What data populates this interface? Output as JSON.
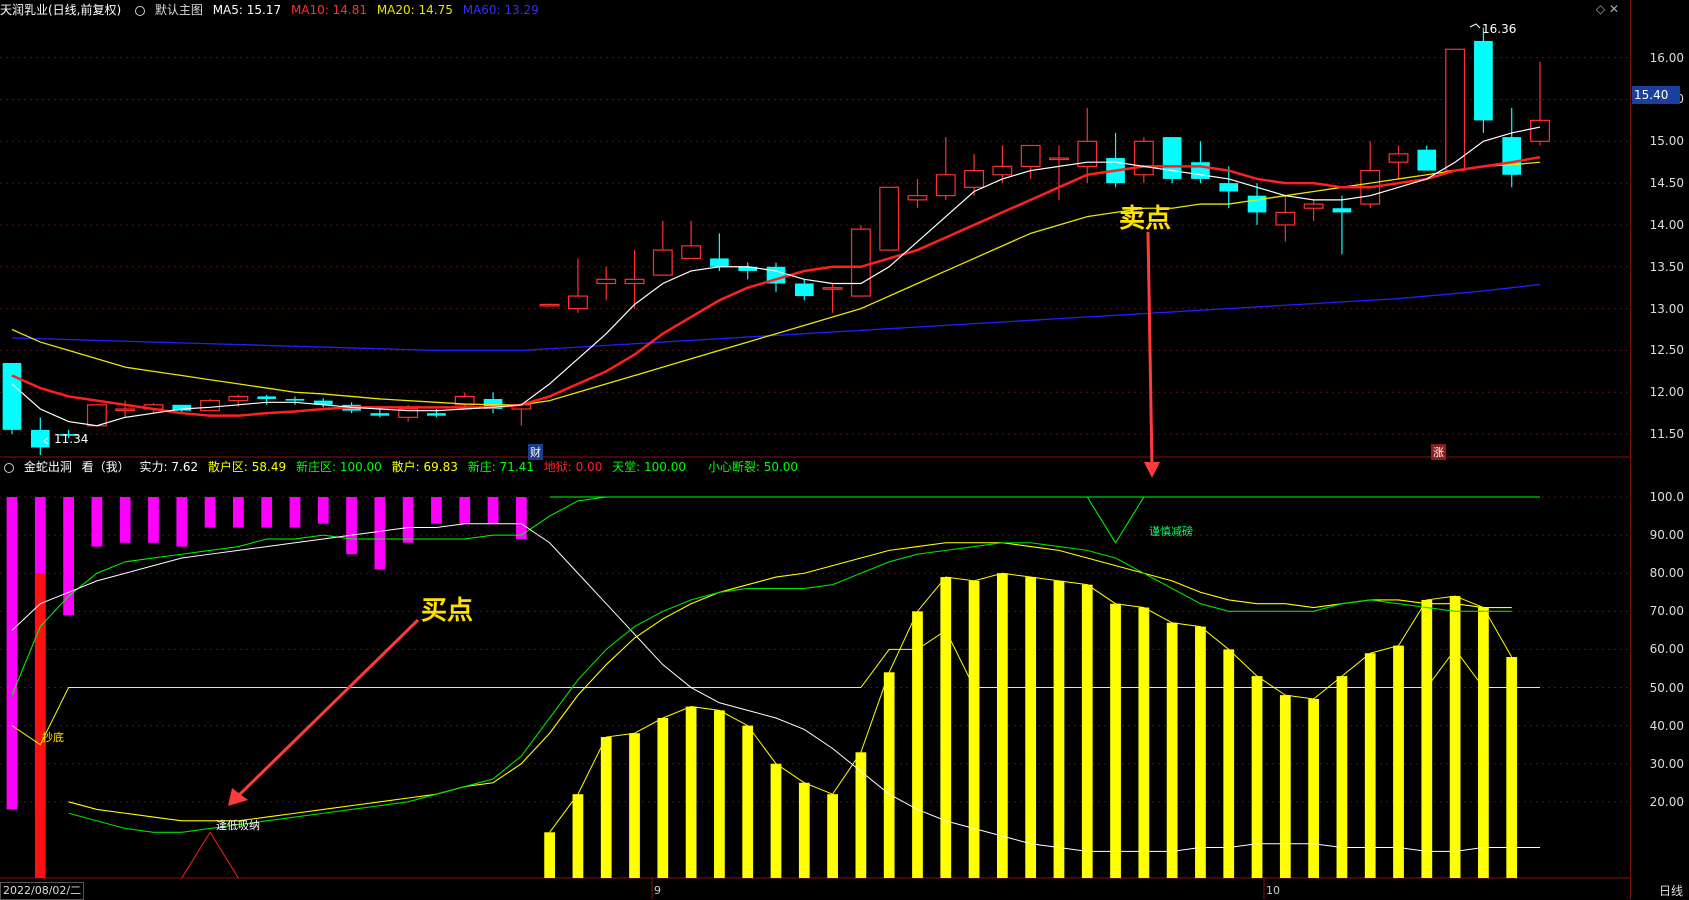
{
  "main_header": {
    "stock": "天润乳业(日线,前复权)",
    "chart_name": "默认主图",
    "ma5": "MA5: 15.17",
    "ma10": "MA10: 14.81",
    "ma20": "MA20: 14.75",
    "ma60": "MA60: 13.29"
  },
  "indicator_header": {
    "name": "金蛇出洞",
    "view": "看（我）",
    "strength": "实力: 7.62",
    "retail_zone": "散户区: 58.49",
    "new_dealer_zone": "新庄区: 100.00",
    "retail": "散户: 69.83",
    "new_dealer": "新庄: 71.41",
    "hell": "地狱: 0.00",
    "heaven": "天堂: 100.00",
    "caution": "小心断裂: 50.00"
  },
  "colors": {
    "ma5": "#ffffff",
    "ma10": "#ff2020",
    "ma20": "#e6e600",
    "ma60": "#2020ff",
    "up": "#ff3030",
    "down": "#00ffff",
    "accent_yellow": "#ffe100"
  },
  "price_axis": [
    "16.00",
    "15.50",
    "15.00",
    "14.50",
    "14.00",
    "13.50",
    "13.00",
    "12.50",
    "12.00",
    "11.50"
  ],
  "current_price": "15.40",
  "indicator_axis": [
    "100.0",
    "90.00",
    "80.00",
    "70.00",
    "60.00",
    "50.00",
    "40.00",
    "30.00",
    "20.00"
  ],
  "annotations": {
    "sell_point": "卖点",
    "buy_point": "买点",
    "high": "16.36",
    "low": "11.34",
    "cai": "财",
    "zhang": "涨",
    "low_absorb": "逢低吸纳",
    "caution_break": "谨慎减磅",
    "chao_di": "抄底"
  },
  "x_axis": {
    "date": "2022/08/02/二",
    "m9": "9",
    "m10": "10",
    "period": "日线"
  },
  "chart_data": {
    "type": "candlestick",
    "ohlc": [
      [
        12.35,
        12.35,
        11.5,
        11.55
      ],
      [
        11.55,
        11.7,
        11.25,
        11.34
      ],
      [
        11.5,
        11.55,
        11.45,
        11.48
      ],
      [
        11.6,
        11.85,
        11.6,
        11.85
      ],
      [
        11.8,
        11.9,
        11.7,
        11.8
      ],
      [
        11.8,
        11.87,
        11.75,
        11.85
      ],
      [
        11.85,
        11.85,
        11.75,
        11.78
      ],
      [
        11.78,
        11.92,
        11.8,
        11.9
      ],
      [
        11.9,
        11.97,
        11.83,
        11.95
      ],
      [
        11.95,
        11.97,
        11.85,
        11.92
      ],
      [
        11.92,
        11.95,
        11.85,
        11.9
      ],
      [
        11.9,
        11.93,
        11.82,
        11.85
      ],
      [
        11.85,
        11.88,
        11.75,
        11.78
      ],
      [
        11.75,
        11.8,
        11.7,
        11.72
      ],
      [
        11.7,
        11.85,
        11.65,
        11.8
      ],
      [
        11.75,
        11.8,
        11.7,
        11.72
      ],
      [
        11.85,
        12.0,
        11.8,
        11.95
      ],
      [
        11.92,
        12.0,
        11.75,
        11.8
      ],
      [
        11.8,
        11.85,
        11.6,
        11.85
      ],
      [
        13.05,
        13.06,
        13.04,
        13.05
      ],
      [
        13.0,
        13.6,
        12.95,
        13.15
      ],
      [
        13.3,
        13.5,
        13.1,
        13.35
      ],
      [
        13.3,
        13.7,
        13.0,
        13.35
      ],
      [
        13.4,
        14.05,
        13.4,
        13.7
      ],
      [
        13.6,
        14.05,
        13.6,
        13.75
      ],
      [
        13.6,
        13.9,
        13.45,
        13.5
      ],
      [
        13.5,
        13.55,
        13.35,
        13.45
      ],
      [
        13.5,
        13.55,
        13.2,
        13.3
      ],
      [
        13.3,
        13.35,
        13.1,
        13.15
      ],
      [
        13.25,
        13.3,
        12.95,
        13.25
      ],
      [
        13.15,
        14.0,
        13.15,
        13.95
      ],
      [
        13.7,
        14.45,
        13.7,
        14.45
      ],
      [
        14.3,
        14.55,
        14.2,
        14.35
      ],
      [
        14.35,
        15.05,
        14.3,
        14.6
      ],
      [
        14.45,
        14.85,
        14.35,
        14.65
      ],
      [
        14.6,
        14.95,
        14.5,
        14.7
      ],
      [
        14.7,
        14.95,
        14.55,
        14.95
      ],
      [
        14.8,
        14.95,
        14.3,
        14.8
      ],
      [
        14.7,
        15.4,
        14.5,
        15.0
      ],
      [
        14.8,
        15.1,
        14.45,
        14.5
      ],
      [
        14.6,
        15.05,
        14.5,
        15.0
      ],
      [
        15.05,
        15.05,
        14.5,
        14.55
      ],
      [
        14.75,
        15.0,
        14.5,
        14.55
      ],
      [
        14.5,
        14.7,
        14.2,
        14.4
      ],
      [
        14.35,
        14.5,
        14.0,
        14.15
      ],
      [
        14.0,
        14.35,
        13.8,
        14.15
      ],
      [
        14.2,
        14.3,
        14.05,
        14.25
      ],
      [
        14.2,
        14.35,
        13.65,
        14.15
      ],
      [
        14.25,
        15.0,
        14.2,
        14.65
      ],
      [
        14.75,
        14.95,
        14.55,
        14.85
      ],
      [
        14.9,
        14.95,
        14.65,
        14.65
      ],
      [
        14.65,
        16.1,
        14.65,
        16.1
      ],
      [
        16.2,
        16.36,
        15.1,
        15.25
      ],
      [
        15.05,
        15.4,
        14.45,
        14.6
      ],
      [
        15.0,
        15.95,
        14.95,
        15.25
      ]
    ],
    "ma5_close": [
      12.1,
      11.8,
      11.65,
      11.6,
      11.7,
      11.75,
      11.8,
      11.82,
      11.85,
      11.88,
      11.88,
      11.85,
      11.82,
      11.8,
      11.78,
      11.78,
      11.8,
      11.82,
      11.85,
      12.1,
      12.4,
      12.7,
      13.05,
      13.3,
      13.45,
      13.5,
      13.5,
      13.45,
      13.35,
      13.3,
      13.3,
      13.5,
      13.8,
      14.1,
      14.4,
      14.55,
      14.65,
      14.7,
      14.75,
      14.75,
      14.7,
      14.65,
      14.6,
      14.55,
      14.45,
      14.35,
      14.3,
      14.3,
      14.35,
      14.45,
      14.55,
      14.75,
      15.0,
      15.1,
      15.17
    ],
    "ma10_close": [
      12.2,
      12.05,
      11.95,
      11.9,
      11.85,
      11.8,
      11.75,
      11.72,
      11.72,
      11.75,
      11.77,
      11.8,
      11.82,
      11.82,
      11.82,
      11.82,
      11.82,
      11.82,
      11.85,
      11.95,
      12.1,
      12.25,
      12.45,
      12.7,
      12.9,
      13.1,
      13.25,
      13.35,
      13.45,
      13.5,
      13.5,
      13.6,
      13.7,
      13.85,
      14.0,
      14.15,
      14.3,
      14.45,
      14.6,
      14.65,
      14.7,
      14.7,
      14.7,
      14.65,
      14.55,
      14.5,
      14.5,
      14.45,
      14.45,
      14.5,
      14.55,
      14.65,
      14.7,
      14.75,
      14.81
    ],
    "ma20_close": [
      12.75,
      12.6,
      12.5,
      12.4,
      12.3,
      12.25,
      12.2,
      12.15,
      12.1,
      12.05,
      12.0,
      11.98,
      11.95,
      11.92,
      11.9,
      11.88,
      11.86,
      11.85,
      11.85,
      11.9,
      12.0,
      12.1,
      12.2,
      12.3,
      12.4,
      12.5,
      12.6,
      12.7,
      12.8,
      12.9,
      13.0,
      13.15,
      13.3,
      13.45,
      13.6,
      13.75,
      13.9,
      14.0,
      14.1,
      14.15,
      14.2,
      14.2,
      14.25,
      14.25,
      14.3,
      14.35,
      14.4,
      14.45,
      14.5,
      14.55,
      14.6,
      14.65,
      14.7,
      14.72,
      14.75
    ],
    "ma60_close": [
      12.65,
      12.64,
      12.63,
      12.62,
      12.61,
      12.6,
      12.59,
      12.58,
      12.57,
      12.56,
      12.55,
      12.54,
      12.53,
      12.52,
      12.51,
      12.5,
      12.5,
      12.5,
      12.5,
      12.52,
      12.54,
      12.56,
      12.58,
      12.6,
      12.62,
      12.64,
      12.66,
      12.68,
      12.7,
      12.72,
      12.74,
      12.76,
      12.78,
      12.8,
      12.82,
      12.84,
      12.86,
      12.88,
      12.9,
      12.92,
      12.94,
      12.96,
      12.98,
      13.0,
      13.02,
      13.04,
      13.06,
      13.08,
      13.1,
      13.12,
      13.15,
      13.18,
      13.21,
      13.25,
      13.29
    ],
    "indicator_yellow_bars": [
      0,
      0,
      0,
      0,
      0,
      0,
      0,
      0,
      0,
      0,
      0,
      0,
      0,
      0,
      0,
      0,
      0,
      0,
      0,
      12,
      22,
      37,
      38,
      42,
      45,
      44,
      40,
      30,
      25,
      22,
      33,
      54,
      70,
      79,
      78,
      80,
      79,
      78,
      77,
      72,
      71,
      67,
      66,
      60,
      53,
      48,
      47,
      53,
      59,
      61,
      73,
      74,
      71,
      58,
      0
    ],
    "indicator_magenta_bars": [
      100,
      100,
      100,
      100,
      100,
      100,
      100,
      100,
      100,
      100,
      100,
      100,
      100,
      100,
      100,
      100,
      100,
      100,
      100
    ],
    "indicator_magenta_tops": [
      18,
      18,
      69,
      87,
      88,
      88,
      87,
      92,
      92,
      92,
      92,
      93,
      85,
      81,
      88,
      93,
      93,
      93,
      89
    ],
    "ind_white": [
      65,
      72,
      75,
      78,
      80,
      82,
      84,
      85,
      86,
      87,
      88,
      89,
      90,
      91,
      92,
      92,
      93,
      93,
      93,
      88,
      80,
      72,
      64,
      56,
      50,
      46,
      44,
      42,
      39,
      34,
      28,
      22,
      18,
      15,
      13,
      11,
      9,
      8,
      7,
      7,
      7,
      7,
      8,
      8,
      9,
      9,
      9,
      8,
      8,
      8,
      7,
      7,
      8,
      8,
      8
    ],
    "ind_green": [
      48,
      66,
      74,
      80,
      83,
      84,
      85,
      86,
      87,
      89,
      89,
      90,
      89,
      89,
      89,
      89,
      89,
      90,
      90,
      95,
      99,
      100,
      100,
      100,
      100,
      100,
      100,
      100,
      100,
      100,
      100,
      100,
      100,
      100,
      100,
      100,
      100,
      100,
      100,
      100,
      100,
      100,
      100,
      100,
      100,
      100,
      100,
      100,
      100,
      100,
      100,
      100,
      100,
      100,
      100
    ],
    "ind_yellow_line": [
      40,
      35,
      50,
      50,
      50,
      50,
      50,
      50,
      50,
      50,
      50,
      50,
      50,
      50,
      50,
      50,
      50,
      50,
      50,
      50,
      50,
      50,
      50,
      50,
      50,
      50,
      50,
      50,
      50,
      50,
      50,
      60,
      60,
      65,
      50,
      50,
      50,
      50,
      50,
      50,
      50,
      50,
      50,
      50,
      50,
      50,
      50,
      50,
      50,
      50,
      50,
      60,
      50,
      50,
      50
    ],
    "retail_line": [
      20,
      18,
      17,
      16,
      15,
      15,
      15,
      16,
      17,
      18,
      19,
      20,
      21,
      22,
      24,
      25,
      30,
      38,
      48,
      56,
      63,
      68,
      72,
      75,
      77,
      79,
      80,
      82,
      84,
      86,
      87,
      88,
      88,
      88,
      87,
      86,
      84,
      82,
      80,
      78,
      75,
      73,
      72,
      72,
      71,
      72,
      73,
      73,
      72,
      72,
      71,
      71
    ],
    "dealer_line": [
      17,
      15,
      13,
      12,
      12,
      13,
      14,
      15,
      16,
      17,
      18,
      19,
      20,
      22,
      24,
      26,
      32,
      42,
      52,
      60,
      66,
      70,
      73,
      75,
      76,
      76,
      76,
      77,
      80,
      83,
      85,
      86,
      87,
      88,
      88,
      87,
      86,
      84,
      80,
      76,
      72,
      70,
      70,
      70,
      70,
      72,
      73,
      72,
      71,
      70,
      70,
      70
    ]
  }
}
